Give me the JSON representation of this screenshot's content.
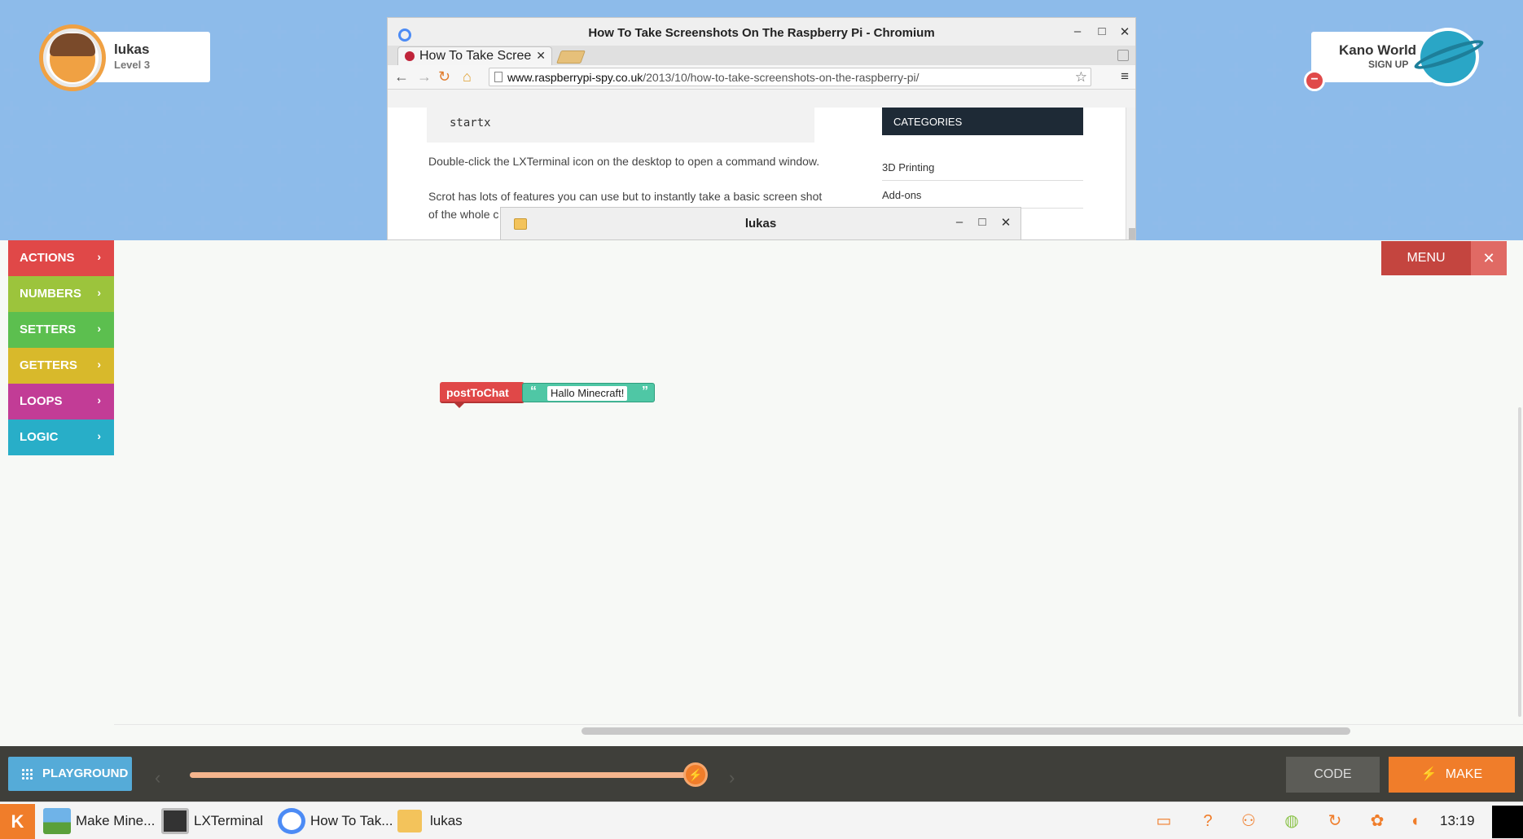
{
  "profile": {
    "name": "lukas",
    "level": "Level 3"
  },
  "kano_world": {
    "title": "Kano World",
    "subtitle": "SIGN UP"
  },
  "chromium": {
    "window_title": "How To Take Screenshots On The Raspberry Pi - Chromium",
    "tab_label": "How To Take Scree",
    "url_host": "www.raspberrypi-spy.co.uk",
    "url_path": "/2013/10/how-to-take-screenshots-on-the-raspberry-pi/",
    "page": {
      "code": "startx",
      "para1": "Double-click the LXTerminal icon on the desktop to open a command window.",
      "para2": "Scrot has lots of features you can use but to instantly take a basic screen shot",
      "para3": "of the whole c",
      "categories_heading": "CATEGORIES",
      "categories": [
        "3D Printing",
        "Add-ons"
      ]
    }
  },
  "file_window": {
    "title": "lukas"
  },
  "palette": {
    "items": [
      {
        "label": "ACTIONS",
        "color": "#e04848"
      },
      {
        "label": "NUMBERS",
        "color": "#9cc43c"
      },
      {
        "label": "SETTERS",
        "color": "#5cbf4f"
      },
      {
        "label": "GETTERS",
        "color": "#d8b92b"
      },
      {
        "label": "LOOPS",
        "color": "#c23c96"
      },
      {
        "label": "LOGIC",
        "color": "#28aec8"
      }
    ]
  },
  "menu": {
    "label": "MENU"
  },
  "blocks": {
    "function": "postToChat",
    "string_value": "Hallo Minecraft!"
  },
  "bottom_bar": {
    "playground_label": "PLAYGROUND",
    "code_label": "CODE",
    "make_label": "MAKE"
  },
  "taskbar": {
    "tasks": [
      {
        "label": "Make Mine..."
      },
      {
        "label": "LXTerminal"
      },
      {
        "label": "How To Tak..."
      },
      {
        "label": "lukas"
      }
    ],
    "clock": "13:19"
  }
}
